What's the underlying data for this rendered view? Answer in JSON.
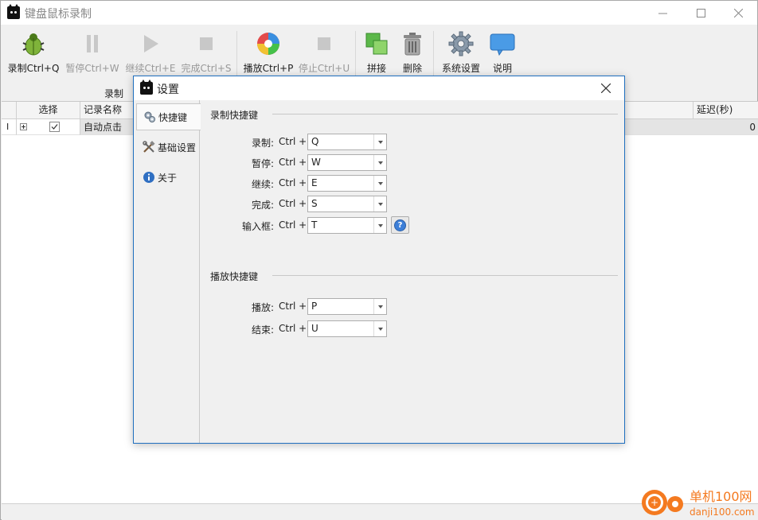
{
  "app": {
    "title": "键盘鼠标录制"
  },
  "toolbar": {
    "buttons": [
      {
        "label": "录制Ctrl+Q",
        "icon": "bug-icon"
      },
      {
        "label": "暂停Ctrl+W",
        "icon": "pause-icon"
      },
      {
        "label": "继续Ctrl+E",
        "icon": "play-icon"
      },
      {
        "label": "完成Ctrl+S",
        "icon": "stop-icon"
      },
      {
        "label": "播放Ctrl+P",
        "icon": "disc-icon"
      },
      {
        "label": "停止Ctrl+U",
        "icon": "stop-icon"
      },
      {
        "label": "拼接",
        "icon": "merge-icon"
      },
      {
        "label": "删除",
        "icon": "trash-icon"
      },
      {
        "label": "系统设置",
        "icon": "gear-icon"
      },
      {
        "label": "说明",
        "icon": "chat-bubble-icon"
      }
    ],
    "group_label": "录制"
  },
  "table": {
    "headers": {
      "select": "选择",
      "name": "记录名称",
      "delay": "延迟(秒)"
    },
    "rows": [
      {
        "marker": "I",
        "checked": true,
        "name": "自动点击",
        "delay": "0"
      }
    ]
  },
  "dialog": {
    "title": "设置",
    "nav": [
      {
        "label": "快捷键",
        "icon": "keys-icon",
        "active": true
      },
      {
        "label": "基础设置",
        "icon": "tools-icon",
        "active": false
      },
      {
        "label": "关于",
        "icon": "info-icon",
        "active": false
      }
    ],
    "record_section": {
      "title": "录制快捷键",
      "rows": [
        {
          "label": "录制:",
          "modifier": "Ctrl +",
          "key": "Q"
        },
        {
          "label": "暂停:",
          "modifier": "Ctrl +",
          "key": "W"
        },
        {
          "label": "继续:",
          "modifier": "Ctrl +",
          "key": "E"
        },
        {
          "label": "完成:",
          "modifier": "Ctrl +",
          "key": "S"
        },
        {
          "label": "输入框:",
          "modifier": "Ctrl +",
          "key": "T"
        }
      ]
    },
    "play_section": {
      "title": "播放快捷键",
      "rows": [
        {
          "label": "播放:",
          "modifier": "Ctrl +",
          "key": "P"
        },
        {
          "label": "结束:",
          "modifier": "Ctrl +",
          "key": "U"
        }
      ]
    }
  },
  "watermark": {
    "name": "单机100网",
    "url": "danji100.com"
  }
}
